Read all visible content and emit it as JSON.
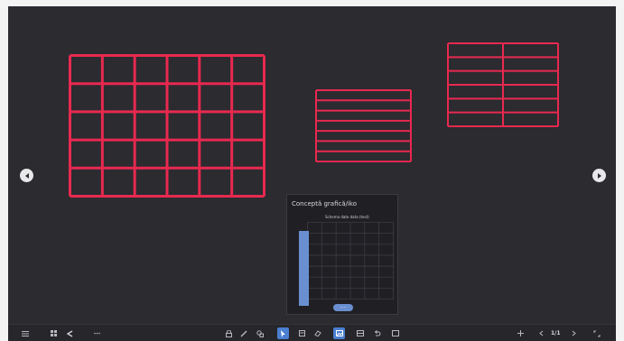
{
  "board": {
    "background": "#2b2b30",
    "table_color": "#e8294f",
    "tables": [
      {
        "name": "table-large",
        "rows": 5,
        "cols": 6
      },
      {
        "name": "table-medium",
        "rows": 7,
        "cols": 1
      },
      {
        "name": "table-right",
        "rows": 6,
        "cols": 2
      }
    ]
  },
  "nav": {
    "prev_icon": "chevron-left-icon",
    "next_icon": "chevron-right-icon"
  },
  "panel": {
    "title": "Conceptă grafică/iko",
    "caption": "Schema date data (test)",
    "toggle_label": "·····",
    "bar_color": "#6a8fd0",
    "bar_fill": 1.0
  },
  "toolbar": {
    "left_icons": [
      "menu-icon",
      "grid-icon",
      "share-icon",
      "more-icon"
    ],
    "center_icons": [
      "lock-icon",
      "pen-icon",
      "shapes-icon",
      "select-icon",
      "note-icon",
      "eraser-icon",
      "image-icon",
      "layout-icon",
      "undo-icon",
      "redo-icon"
    ],
    "active_index": 3,
    "page_indicator": "1/1",
    "accent": "#4a7fd1"
  }
}
